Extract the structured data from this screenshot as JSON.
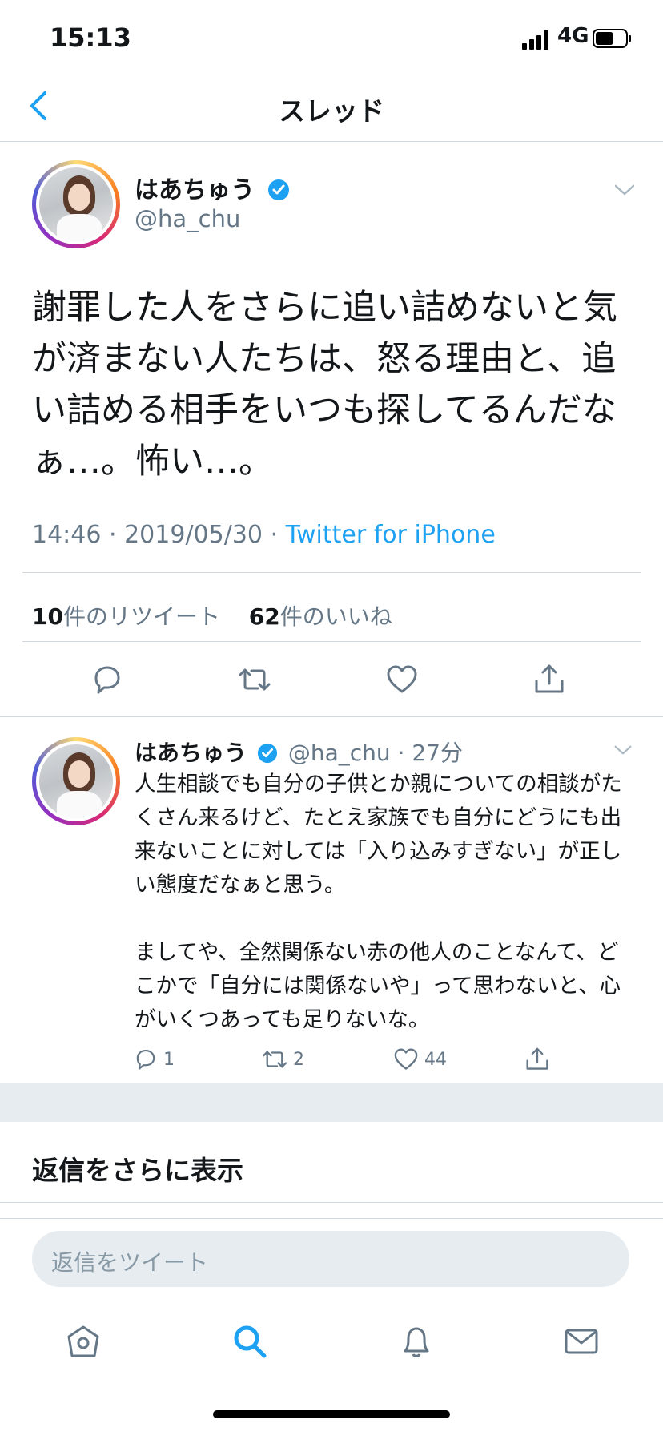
{
  "status_bar": {
    "time": "15:13",
    "network": "4G",
    "battery_level": 0.6
  },
  "nav": {
    "title": "スレッド"
  },
  "main_tweet": {
    "name": "はあちゅう",
    "handle": "@ha_chu",
    "text": "謝罪した人をさらに追い詰めないと気が済まない人たちは、怒る理由と、追い詰める相手をいつも探してるんだなぁ…。怖い…。",
    "time": "14:46",
    "date": "2019/05/30",
    "source": "Twitter for iPhone",
    "retweet_count": "10",
    "retweet_label": "件のリツイート",
    "like_count": "62",
    "like_label": "件のいいね",
    "verified": true
  },
  "reply_tweet": {
    "name": "はあちゅう",
    "handle": "@ha_chu",
    "time_ago": "27分",
    "text": "人生相談でも自分の子供とか親についての相談がたくさん来るけど、たとえ家族でも自分にどうにも出来ないことに対しては「入り込みすぎない」が正しい態度だなぁと思う。\n\nましてや、全然関係ない赤の他人のことなんて、どこかで「自分には関係ないや」って思わないと、心がいくつあっても足りないな。",
    "reply_count": "1",
    "retweet_count": "2",
    "like_count": "44"
  },
  "show_more": "返信をさらに表示",
  "reply_box": {
    "placeholder": "返信をツイート"
  },
  "tabs": [
    "home-icon",
    "search-icon",
    "notifications-icon",
    "messages-icon"
  ],
  "colors": {
    "accent": "#1da1f2",
    "secondary_text": "#657786",
    "active_tab": "#1da1f2",
    "separator": "#e6ecf0"
  }
}
